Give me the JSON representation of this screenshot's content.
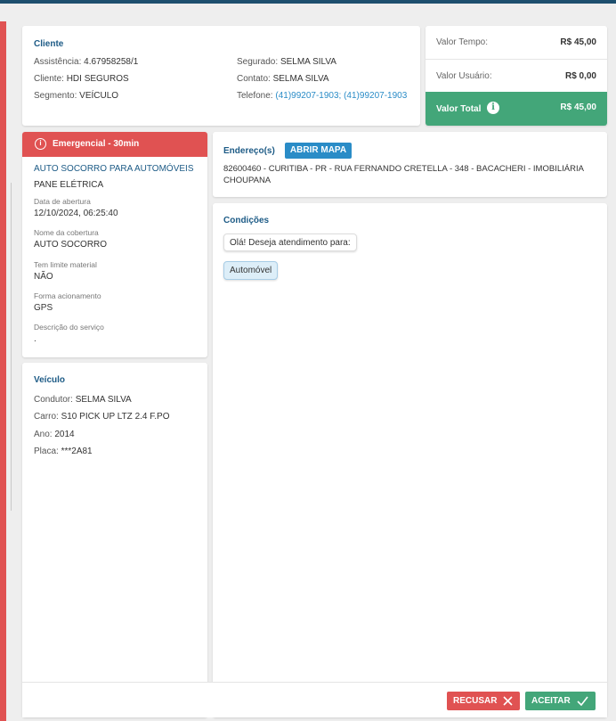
{
  "cliente": {
    "title": "Cliente",
    "assistencia_label": "Assistência:",
    "assistencia": "4.67958258/1",
    "cliente_label": "Cliente:",
    "cliente": "HDI SEGUROS",
    "segmento_label": "Segmento:",
    "segmento": "VEÍCULO",
    "segurado_label": "Segurado:",
    "segurado": "SELMA SILVA",
    "contato_label": "Contato:",
    "contato": "SELMA SILVA",
    "telefone_label": "Telefone:",
    "telefone": "(41)99207-1903; (41)99207-1903"
  },
  "valores": {
    "tempo_label": "Valor Tempo:",
    "tempo": "R$ 45,00",
    "usuario_label": "Valor Usuário:",
    "usuario": "R$ 0,00",
    "total_label": "Valor Total",
    "total": "R$ 45,00",
    "total_color": "#43a679"
  },
  "servico": {
    "banner": "Emergencial - 30min",
    "banner_color": "#e05252",
    "tipo": "AUTO SOCORRO PARA AUTOMÓVEIS",
    "problema": "PANE ELÉTRICA",
    "abertura_label": "Data de abertura",
    "abertura": "12/10/2024, 06:25:40",
    "cobertura_label": "Nome da cobertura",
    "cobertura": "AUTO SOCORRO",
    "limite_label": "Tem limite material",
    "limite": "NÃO",
    "acionamento_label": "Forma acionamento",
    "acionamento": "GPS",
    "descricao_label": "Descrição do serviço",
    "descricao": "."
  },
  "veiculo": {
    "title": "Veículo",
    "condutor_label": "Condutor:",
    "condutor": "SELMA SILVA",
    "carro_label": "Carro:",
    "carro": "S10 PICK UP LTZ 2.4 F.PO",
    "ano_label": "Ano:",
    "ano": "2014",
    "placa_label": "Placa:",
    "placa": "***2A81"
  },
  "endereco": {
    "title": "Endereço(s)",
    "map_button": "ABRIR MAPA",
    "address": "82600460 - CURITIBA - PR - RUA FERNANDO CRETELLA - 348 - BACACHERI - IMOBILIÁRIA CHOUPANA"
  },
  "condicoes": {
    "title": "Condições",
    "message": "Olá! Deseja atendimento para:",
    "option": "Automóvel"
  },
  "footer": {
    "recusar": "RECUSAR",
    "aceitar": "ACEITAR"
  },
  "icons": {
    "info": "info-icon",
    "alert": "alert-circle-icon",
    "close": "close-icon",
    "check": "check-icon"
  }
}
